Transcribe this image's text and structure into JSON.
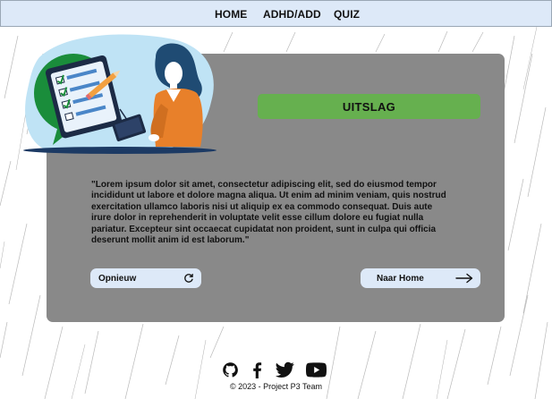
{
  "nav": {
    "items": [
      {
        "label": "HOME"
      },
      {
        "label": "ADHD/ADD"
      },
      {
        "label": "QUIZ"
      }
    ]
  },
  "result": {
    "title": "UITSLAG",
    "text": "\"Lorem ipsum dolor sit amet, consectetur adipiscing elit, sed do eiusmod tempor incididunt ut labore et dolore magna aliqua. Ut enim ad minim veniam, quis nostrud exercitation ullamco laboris nisi ut aliquip ex ea commodo consequat. Duis aute irure dolor in reprehenderit in voluptate velit esse cillum dolore eu fugiat nulla pariatur. Excepteur sint occaecat cupidatat non proident, sunt in culpa qui officia deserunt mollit anim id est laborum.\""
  },
  "actions": {
    "restart_label": "Opnieuw",
    "home_label": "Naar Home"
  },
  "footer": {
    "copyright": "© 2023 - Project P3 Team",
    "icons": [
      "github-icon",
      "facebook-icon",
      "twitter-icon",
      "youtube-icon"
    ]
  },
  "colors": {
    "nav_bg": "#dde9f8",
    "card_bg": "#898989",
    "banner_bg": "#66b04f",
    "button_bg": "#dde9f8"
  }
}
